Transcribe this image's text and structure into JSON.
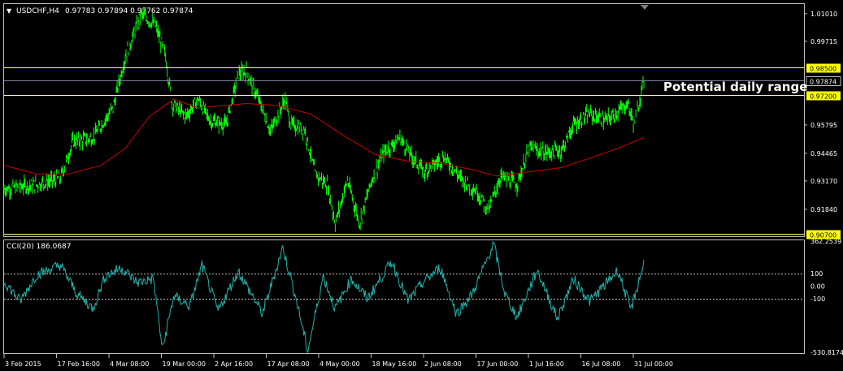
{
  "header": {
    "symbol_label": "USDCHF,H4",
    "ohlc": "0.97783 0.97894 0.97762 0.97874",
    "arrow": "▼"
  },
  "indicator": {
    "label": "CCI(20) 186.0687"
  },
  "annotation": "Potential daily range",
  "colors": {
    "background": "#000000",
    "frame": "#c0c0c0",
    "price": "#00ff00",
    "ma": "#cc0000",
    "cci": "#20b2aa",
    "hline": "#ffff80",
    "bid_line": "#8080a0",
    "tag_fill": "#ffff00"
  },
  "price_axis": {
    "min": 0.9058,
    "max": 1.0146,
    "ticks": [
      "1.01010",
      "0.99715",
      "0.95795",
      "0.94465",
      "0.93170",
      "0.91840"
    ]
  },
  "levels": [
    {
      "value": 0.985,
      "label": "0.98500",
      "style": "yellow"
    },
    {
      "value": 0.97874,
      "label": "0.97874",
      "style": "current"
    },
    {
      "value": 0.972,
      "label": "0.97200",
      "style": "yellow"
    },
    {
      "value": 0.907,
      "label": "0.90700",
      "style": "yellow"
    }
  ],
  "cci_axis": {
    "min": -530.8174,
    "max": 362.2539,
    "ticks": [
      "362.2539",
      "100",
      "0.00",
      "-100",
      "-530.8174"
    ]
  },
  "time_axis": [
    "3 Feb 2015",
    "17 Feb 16:00",
    "4 Mar 08:00",
    "19 Mar 00:00",
    "2 Apr 16:00",
    "17 Apr 08:00",
    "4 May 00:00",
    "18 May 16:00",
    "2 Jun 08:00",
    "17 Jun 00:00",
    "1 Jul 16:00",
    "16 Jul 08:00",
    "31 Jul 00:00"
  ],
  "chart_data": {
    "type": "line",
    "price_series": [
      {
        "i": 0,
        "v": 0.928
      },
      {
        "i": 40,
        "v": 0.93
      },
      {
        "i": 70,
        "v": 0.933
      },
      {
        "i": 85,
        "v": 0.95
      },
      {
        "i": 110,
        "v": 0.952
      },
      {
        "i": 135,
        "v": 0.966
      },
      {
        "i": 150,
        "v": 0.99
      },
      {
        "i": 170,
        "v": 1.01
      },
      {
        "i": 188,
        "v": 1.004
      },
      {
        "i": 200,
        "v": 0.99
      },
      {
        "i": 208,
        "v": 0.968
      },
      {
        "i": 225,
        "v": 0.962
      },
      {
        "i": 240,
        "v": 0.97
      },
      {
        "i": 255,
        "v": 0.96
      },
      {
        "i": 275,
        "v": 0.958
      },
      {
        "i": 290,
        "v": 0.982
      },
      {
        "i": 300,
        "v": 0.983
      },
      {
        "i": 315,
        "v": 0.97
      },
      {
        "i": 330,
        "v": 0.955
      },
      {
        "i": 348,
        "v": 0.97
      },
      {
        "i": 355,
        "v": 0.958
      },
      {
        "i": 372,
        "v": 0.956
      },
      {
        "i": 385,
        "v": 0.935
      },
      {
        "i": 400,
        "v": 0.93
      },
      {
        "i": 410,
        "v": 0.912
      },
      {
        "i": 425,
        "v": 0.932
      },
      {
        "i": 440,
        "v": 0.912
      },
      {
        "i": 455,
        "v": 0.932
      },
      {
        "i": 470,
        "v": 0.945
      },
      {
        "i": 490,
        "v": 0.952
      },
      {
        "i": 505,
        "v": 0.943
      },
      {
        "i": 520,
        "v": 0.936
      },
      {
        "i": 545,
        "v": 0.943
      },
      {
        "i": 565,
        "v": 0.933
      },
      {
        "i": 585,
        "v": 0.927
      },
      {
        "i": 600,
        "v": 0.918
      },
      {
        "i": 615,
        "v": 0.934
      },
      {
        "i": 635,
        "v": 0.93
      },
      {
        "i": 650,
        "v": 0.947
      },
      {
        "i": 670,
        "v": 0.945
      },
      {
        "i": 690,
        "v": 0.946
      },
      {
        "i": 705,
        "v": 0.958
      },
      {
        "i": 725,
        "v": 0.963
      },
      {
        "i": 745,
        "v": 0.96
      },
      {
        "i": 760,
        "v": 0.964
      },
      {
        "i": 772,
        "v": 0.968
      },
      {
        "i": 780,
        "v": 0.958
      },
      {
        "i": 792,
        "v": 0.9787
      }
    ],
    "ma_series": [
      {
        "i": 0,
        "v": 0.939
      },
      {
        "i": 40,
        "v": 0.935
      },
      {
        "i": 80,
        "v": 0.935
      },
      {
        "i": 120,
        "v": 0.939
      },
      {
        "i": 150,
        "v": 0.947
      },
      {
        "i": 180,
        "v": 0.962
      },
      {
        "i": 210,
        "v": 0.97
      },
      {
        "i": 240,
        "v": 0.966
      },
      {
        "i": 300,
        "v": 0.968
      },
      {
        "i": 340,
        "v": 0.967
      },
      {
        "i": 380,
        "v": 0.963
      },
      {
        "i": 420,
        "v": 0.953
      },
      {
        "i": 460,
        "v": 0.944
      },
      {
        "i": 500,
        "v": 0.941
      },
      {
        "i": 540,
        "v": 0.94
      },
      {
        "i": 580,
        "v": 0.937
      },
      {
        "i": 610,
        "v": 0.934
      },
      {
        "i": 650,
        "v": 0.936
      },
      {
        "i": 690,
        "v": 0.938
      },
      {
        "i": 730,
        "v": 0.943
      },
      {
        "i": 760,
        "v": 0.947
      },
      {
        "i": 792,
        "v": 0.952
      }
    ],
    "cci_series": [
      {
        "i": 0,
        "v": 40
      },
      {
        "i": 20,
        "v": -120
      },
      {
        "i": 40,
        "v": 90
      },
      {
        "i": 70,
        "v": 170
      },
      {
        "i": 90,
        "v": -60
      },
      {
        "i": 110,
        "v": -180
      },
      {
        "i": 125,
        "v": 80
      },
      {
        "i": 145,
        "v": 150
      },
      {
        "i": 165,
        "v": 30
      },
      {
        "i": 185,
        "v": 60
      },
      {
        "i": 196,
        "v": -510
      },
      {
        "i": 210,
        "v": -80
      },
      {
        "i": 230,
        "v": -160
      },
      {
        "i": 245,
        "v": 170
      },
      {
        "i": 265,
        "v": -200
      },
      {
        "i": 290,
        "v": 120
      },
      {
        "i": 320,
        "v": -220
      },
      {
        "i": 345,
        "v": 310
      },
      {
        "i": 360,
        "v": -60
      },
      {
        "i": 376,
        "v": -520
      },
      {
        "i": 395,
        "v": 80
      },
      {
        "i": 410,
        "v": -180
      },
      {
        "i": 430,
        "v": 60
      },
      {
        "i": 450,
        "v": -100
      },
      {
        "i": 480,
        "v": 200
      },
      {
        "i": 500,
        "v": -120
      },
      {
        "i": 520,
        "v": 40
      },
      {
        "i": 540,
        "v": 150
      },
      {
        "i": 560,
        "v": -220
      },
      {
        "i": 580,
        "v": -60
      },
      {
        "i": 606,
        "v": 340
      },
      {
        "i": 620,
        "v": -60
      },
      {
        "i": 635,
        "v": -250
      },
      {
        "i": 660,
        "v": 130
      },
      {
        "i": 685,
        "v": -260
      },
      {
        "i": 705,
        "v": 60
      },
      {
        "i": 725,
        "v": -120
      },
      {
        "i": 745,
        "v": 20
      },
      {
        "i": 760,
        "v": 130
      },
      {
        "i": 776,
        "v": -190
      },
      {
        "i": 792,
        "v": 186
      }
    ]
  }
}
